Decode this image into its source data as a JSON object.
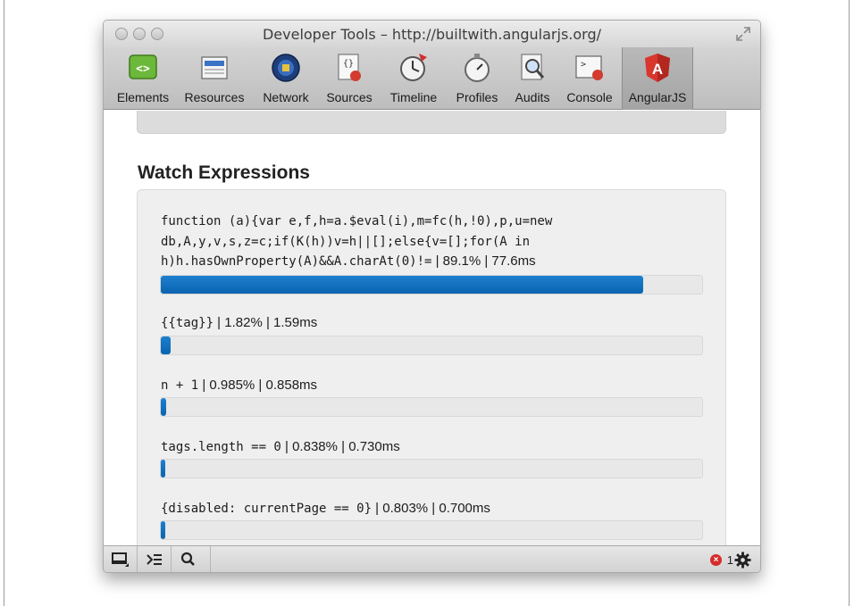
{
  "window": {
    "title": "Developer Tools – http://builtwith.angularjs.org/"
  },
  "toolbar": {
    "tabs": [
      {
        "label": "Elements",
        "icon": "elements-icon"
      },
      {
        "label": "Resources",
        "icon": "resources-icon"
      },
      {
        "label": "Network",
        "icon": "network-icon"
      },
      {
        "label": "Sources",
        "icon": "sources-icon"
      },
      {
        "label": "Timeline",
        "icon": "timeline-icon"
      },
      {
        "label": "Profiles",
        "icon": "profiles-icon"
      },
      {
        "label": "Audits",
        "icon": "audits-icon"
      },
      {
        "label": "Console",
        "icon": "console-icon"
      },
      {
        "label": "AngularJS",
        "icon": "angularjs-icon",
        "active": true
      }
    ]
  },
  "main": {
    "section_title": "Watch Expressions",
    "watches": [
      {
        "code_lines": [
          "function (a){var e,f,h=a.$eval(i),m=fc(h,!0),p,u=new",
          "db,A,y,v,s,z=c;if(K(h))v=h||[];else{v=[];for(A in",
          "h)h.hasOwnProperty(A)&&A.charAt(0)!="
        ],
        "stats": " | 89.1% | 77.6ms",
        "percent": 89.1
      },
      {
        "code_lines": [
          "{{tag}}"
        ],
        "stats": " | 1.82% | 1.59ms",
        "percent": 1.82
      },
      {
        "code_lines": [
          "n + 1"
        ],
        "stats": " | 0.985% | 0.858ms",
        "percent": 0.985
      },
      {
        "code_lines": [
          "tags.length == 0"
        ],
        "stats": " | 0.838% | 0.730ms",
        "percent": 0.838
      },
      {
        "code_lines": [
          "{disabled: currentPage == 0}"
        ],
        "stats": " | 0.803% | 0.700ms",
        "percent": 0.803
      }
    ]
  },
  "statusbar": {
    "error_count": "1"
  },
  "colors": {
    "bar_fill": "#0a64b0",
    "error_badge": "#d52b2b"
  }
}
